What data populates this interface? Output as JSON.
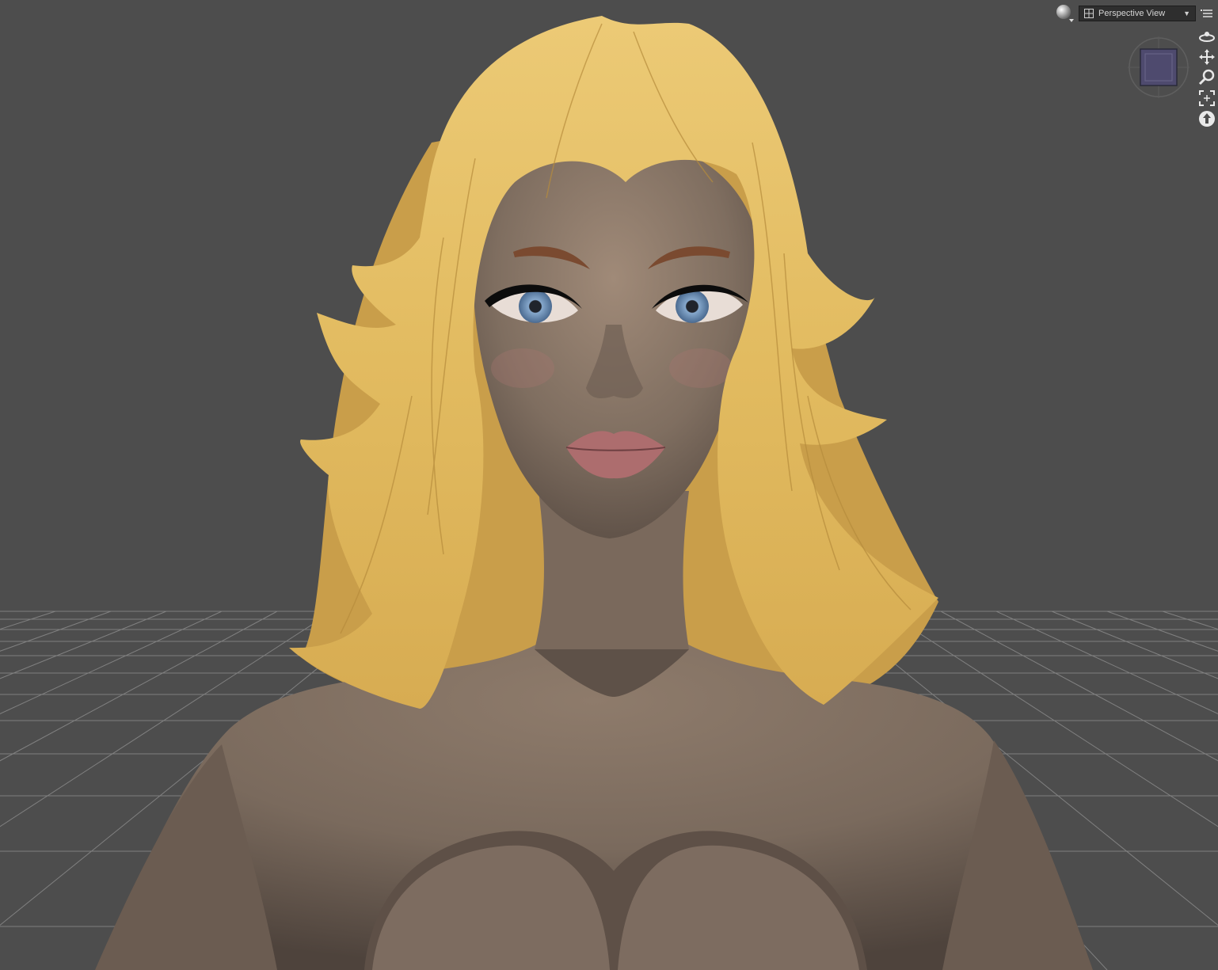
{
  "viewport": {
    "background": "#4d4d4d",
    "grid_color": "#8a8a8a"
  },
  "toolbar": {
    "view_selector": {
      "label": "Perspective View"
    },
    "shading_icon": "sphere-icon",
    "menu_icon": "options-menu-icon"
  },
  "nav_cube": {
    "face_color": "#4e4a6e"
  },
  "nav_tools": [
    {
      "icon": "orbit-icon"
    },
    {
      "icon": "pan-icon"
    },
    {
      "icon": "zoom-icon"
    },
    {
      "icon": "frame-icon"
    },
    {
      "icon": "reset-up-icon"
    }
  ],
  "colors": {
    "hair": "#e3bd63",
    "skin": "#8a7868",
    "iris": "#6b8fb8",
    "lips": "#b07072"
  }
}
